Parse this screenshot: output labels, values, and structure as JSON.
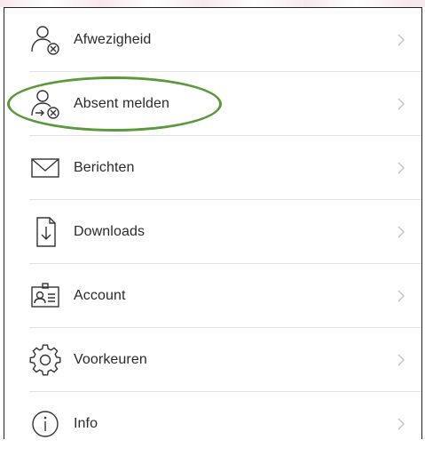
{
  "menu": {
    "items": [
      {
        "label": "Afwezigheid",
        "icon": "person-cancel-icon"
      },
      {
        "label": "Absent melden",
        "icon": "person-absent-icon",
        "highlighted": true
      },
      {
        "label": "Berichten",
        "icon": "envelope-icon"
      },
      {
        "label": "Downloads",
        "icon": "download-document-icon"
      },
      {
        "label": "Account",
        "icon": "id-card-icon"
      },
      {
        "label": "Voorkeuren",
        "icon": "gear-icon"
      },
      {
        "label": "Info",
        "icon": "info-icon"
      }
    ]
  },
  "colors": {
    "highlight": "#5b9a3a",
    "text": "#2a2a2a",
    "chevron": "#c2c2c2",
    "separator": "#e3e3e3"
  }
}
